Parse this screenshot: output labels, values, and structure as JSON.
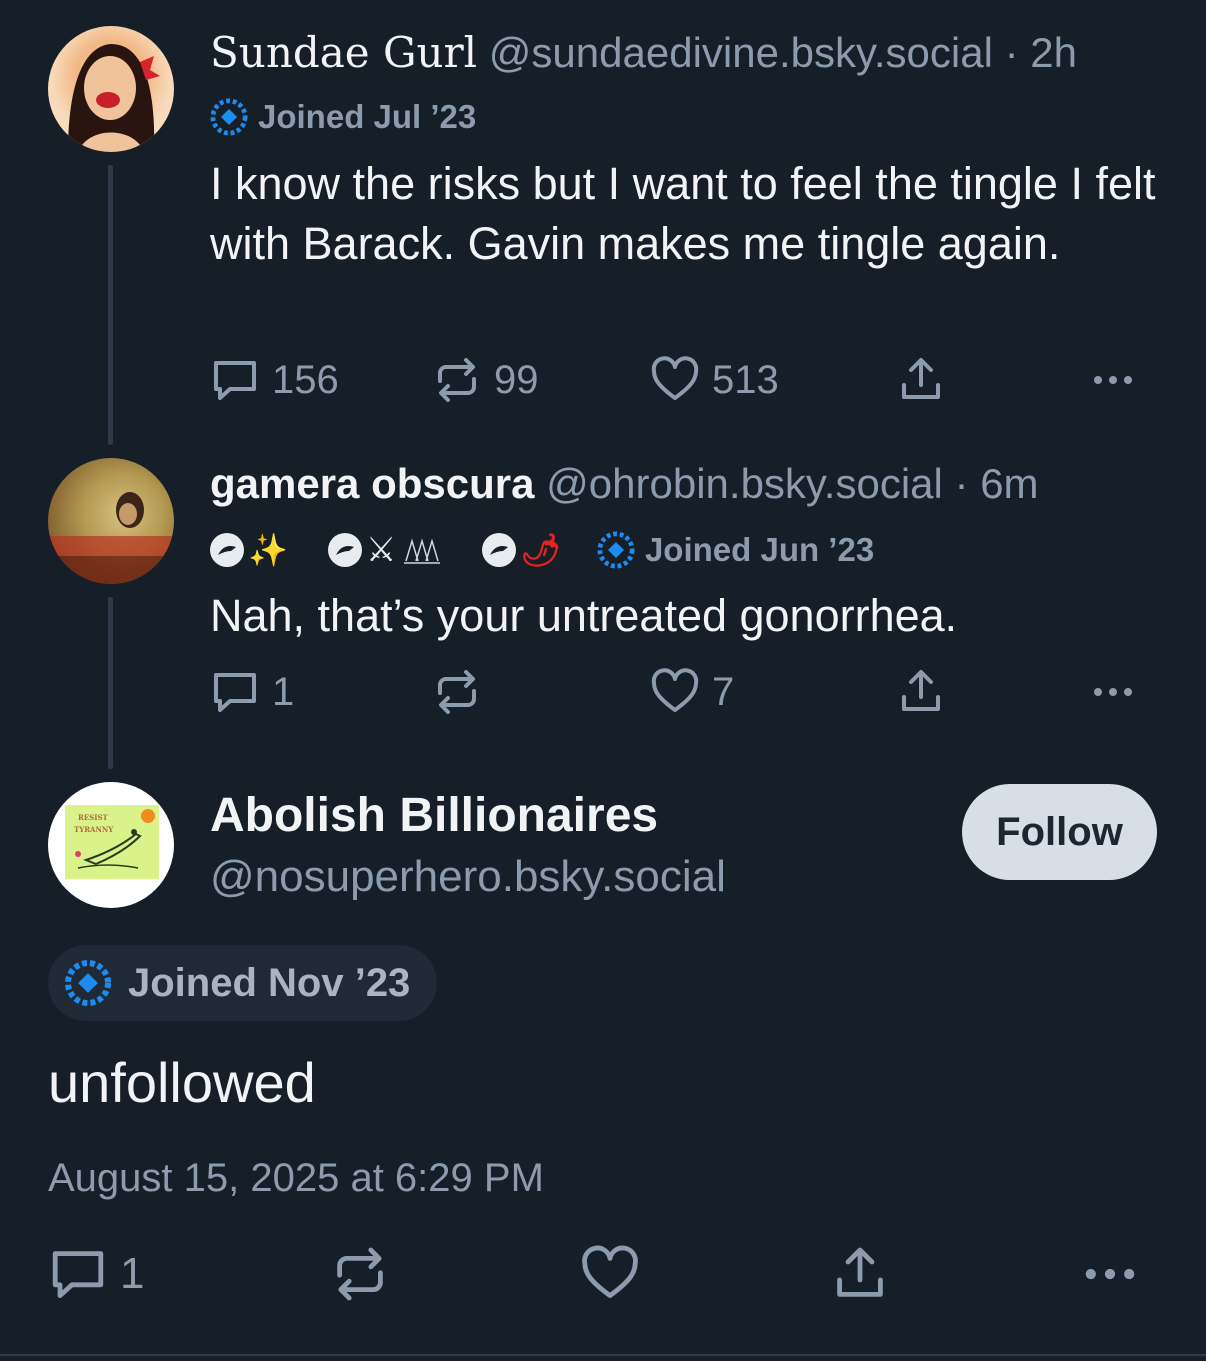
{
  "post1": {
    "display_name": "Sundae Gurl",
    "handle": "@sundaedivine.bsky.social",
    "separator": " · ",
    "time": "2h",
    "joined": "Joined Jul ’23",
    "text": "I know the risks but I want to feel the tingle I felt with Barack. Gavin makes me tingle again.",
    "replies": "156",
    "reposts": "99",
    "likes": "513"
  },
  "post2": {
    "display_name": "gamera obscura",
    "handle": "@ohrobin.bsky.social",
    "separator": " · ",
    "time": "6m",
    "emoji1": "✨",
    "emoji2": "⚔",
    "emoji3": "🌶",
    "joined": "Joined Jun ’23",
    "text": "Nah, that’s your untreated gonorrhea.",
    "replies": "1",
    "reposts": "",
    "likes": "7"
  },
  "main_post": {
    "display_name": "Abolish Billionaires",
    "handle": "@nosuperhero.bsky.social",
    "follow_label": "Follow",
    "joined": "Joined Nov ’23",
    "avatar_text_line1": "RESIST",
    "avatar_text_line2": "TYRANNY",
    "text": "unfollowed",
    "timestamp": "August 15, 2025 at 6:29 PM",
    "replies": "1"
  },
  "colors": {
    "background": "#161e27",
    "muted": "#8d9cad",
    "accent_blue": "#1d8cf0"
  }
}
